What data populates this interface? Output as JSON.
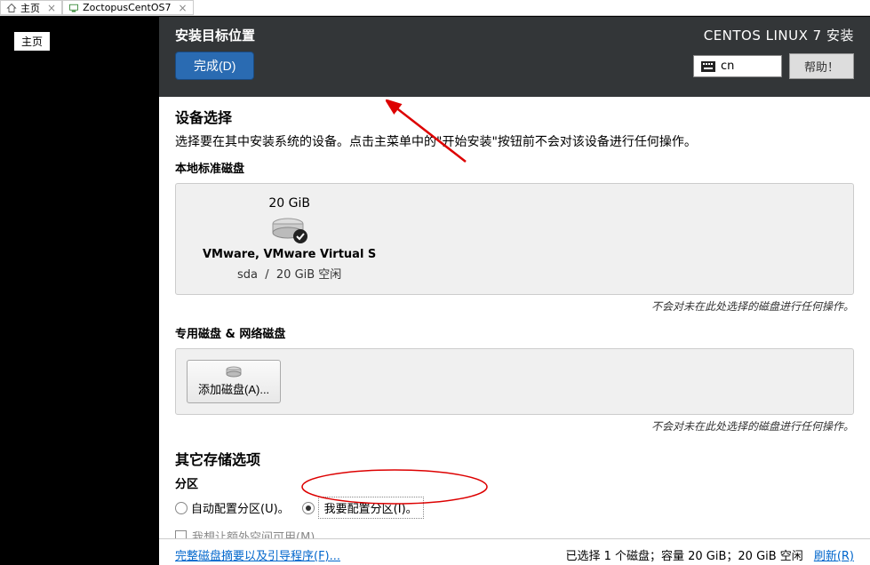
{
  "tabs": [
    {
      "label": "主页",
      "icon": "home"
    },
    {
      "label": "ZoctopusCentOS7",
      "icon": "vm"
    }
  ],
  "tooltip": "主页",
  "header": {
    "title": "安装目标位置",
    "done_btn": "完成(D)",
    "brand": "CENTOS LINUX 7 安装",
    "lang": "cn",
    "help": "帮助！"
  },
  "device_section": {
    "title": "设备选择",
    "subtitle": "选择要在其中安装系统的设备。点击主菜单中的\"开始安装\"按钮前不会对该设备进行任何操作。",
    "local_title": "本地标准磁盘",
    "disk": {
      "size": "20 GiB",
      "name": "VMware, VMware Virtual S",
      "dev": "sda",
      "free": "20 GiB 空闲"
    },
    "hint": "不会对未在此处选择的磁盘进行任何操作。",
    "special_title": "专用磁盘 & 网络磁盘",
    "add_disk": "添加磁盘(A)..."
  },
  "storage_section": {
    "title": "其它存储选项",
    "partition_label": "分区",
    "radio_auto": "自动配置分区(U)。",
    "radio_manual": "我要配置分区(I)。",
    "extra_checkbox": "我想让额外空间可用(M)。"
  },
  "footer": {
    "summary": "完整磁盘摘要以及引导程序(F)...",
    "status": "已选择 1 个磁盘；容量 20 GiB；20 GiB 空闲",
    "refresh": "刷新(R)"
  }
}
